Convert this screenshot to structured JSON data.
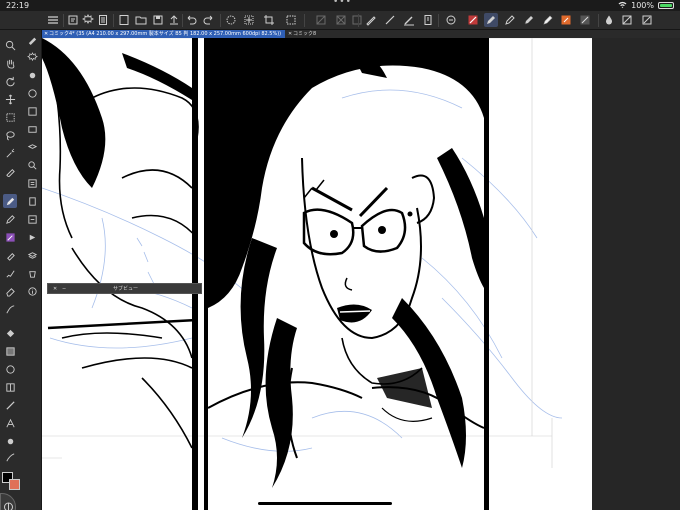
{
  "status_bar": {
    "time": "22:19",
    "dots": "•••",
    "battery_label": "100%",
    "battery_level": 1.0
  },
  "toolbar": {
    "icons": [
      "menu-icon",
      "undo-history-icon",
      "settings-icon",
      "new-file-icon",
      "open-folder-icon",
      "save-icon",
      "upload-icon",
      "undo-icon",
      "redo-icon",
      "selection-clear-icon",
      "transform-icon",
      "deselect-icon",
      "invert-selection-icon",
      "fill-selection-icon",
      "pen-stroke-icon",
      "brush-icon",
      "ruler-icon",
      "layer-icon",
      "snap-icon",
      "pen-tool-icon",
      "pen-icon",
      "brush-tool-icon",
      "marker-icon",
      "eraser-icon",
      "fill-icon",
      "color-icon",
      "expand-icon"
    ]
  },
  "tabs": [
    {
      "label": "コミック4* (35 (A4 210.00 x 297.00mm 製本サイズ B5 判 182.00 x 257.00mm 600dpi 82.5%))",
      "active": true
    },
    {
      "label": "コミック8",
      "active": false
    }
  ],
  "left_tools": [
    "zoom-icon",
    "hand-icon",
    "rotate-icon",
    "move-icon",
    "select-icon",
    "lasso-icon",
    "auto-select-icon",
    "eyedropper-icon",
    "pen-icon",
    "pencil-icon",
    "brush-icon",
    "airbrush-icon",
    "decoration-icon",
    "eraser-icon",
    "blend-icon",
    "fill-icon",
    "gradient-icon",
    "figure-icon",
    "frame-icon",
    "ruler-icon",
    "text-icon",
    "balloon-icon",
    "line-correction-icon",
    "color-picker-icon"
  ],
  "colors": {
    "foreground": "#000000",
    "background": "#e07058",
    "accent": "#2f5fb5",
    "active_tool": "#4b5b85"
  },
  "subview": {
    "close": "✕",
    "minimize": "−",
    "title": "サブビュー"
  }
}
